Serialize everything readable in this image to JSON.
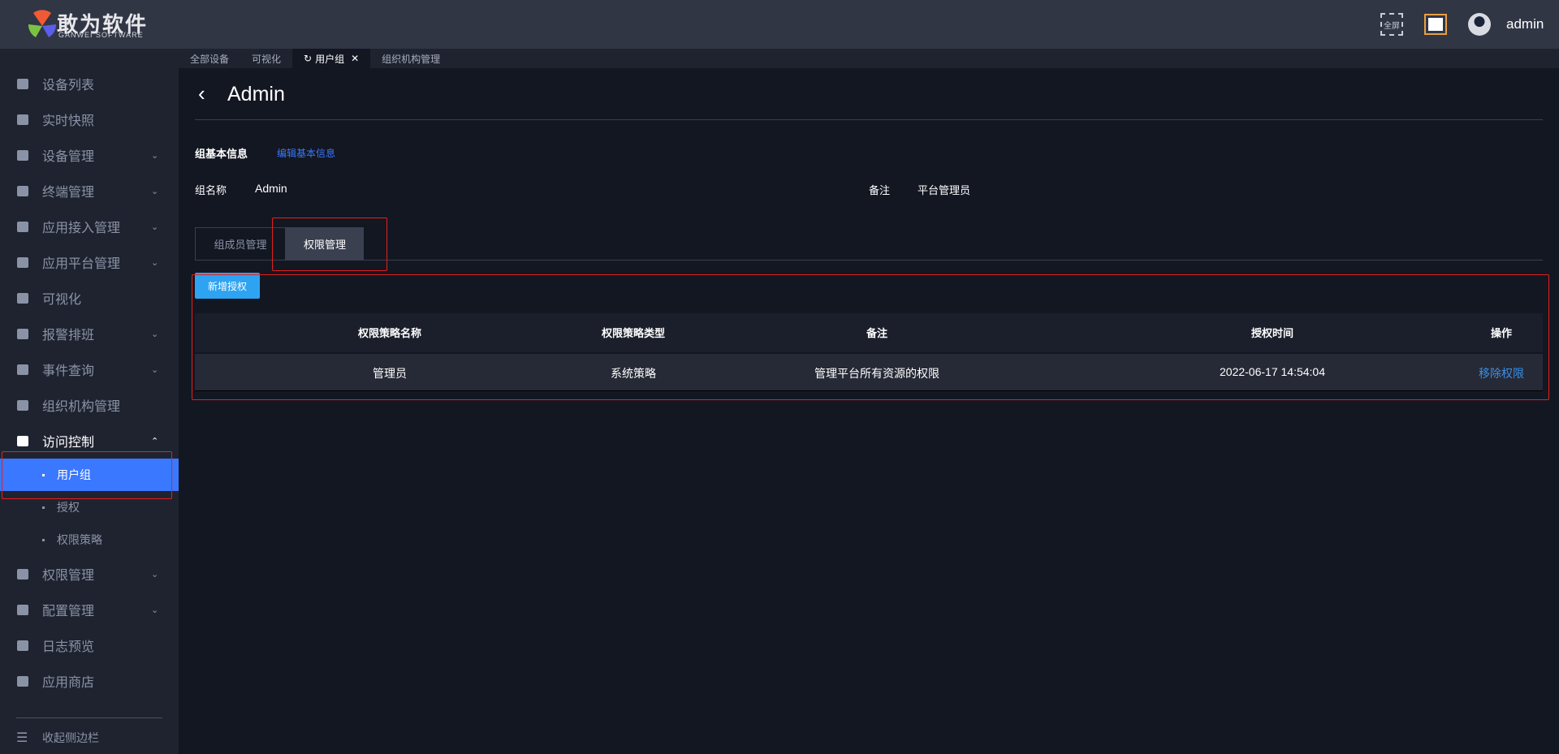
{
  "header": {
    "brand": "敢为软件",
    "brand_sub": "GANWEI SOFTWARE",
    "fullscreen_label": "全屏",
    "username": "admin"
  },
  "tabs": [
    {
      "label": "全部设备"
    },
    {
      "label": "可视化"
    },
    {
      "label": "用户组"
    },
    {
      "label": "组织机构管理"
    }
  ],
  "sidebar": {
    "items": [
      {
        "label": "设备列表",
        "icon": "monitor-icon"
      },
      {
        "label": "实时快照",
        "icon": "camera-icon"
      },
      {
        "label": "设备管理",
        "icon": "grid-icon",
        "chevron": true
      },
      {
        "label": "终端管理",
        "icon": "grid-icon",
        "chevron": true
      },
      {
        "label": "应用接入管理",
        "icon": "grid-icon",
        "chevron": true
      },
      {
        "label": "应用平台管理",
        "icon": "grid-icon",
        "chevron": true
      },
      {
        "label": "可视化",
        "icon": "grid-icon"
      },
      {
        "label": "报警排班",
        "icon": "calendar-icon",
        "chevron": true
      },
      {
        "label": "事件查询",
        "icon": "search-doc-icon",
        "chevron": true
      },
      {
        "label": "组织机构管理",
        "icon": "gear-icon"
      },
      {
        "label": "访问控制",
        "icon": "document-icon"
      }
    ],
    "subitems": [
      {
        "label": "用户组"
      },
      {
        "label": "授权"
      },
      {
        "label": "权限策略"
      }
    ],
    "items2": [
      {
        "label": "权限管理",
        "icon": "shield-icon",
        "chevron": true
      },
      {
        "label": "配置管理",
        "icon": "bookmark-icon",
        "chevron": true
      },
      {
        "label": "日志预览",
        "icon": "document-icon"
      },
      {
        "label": "应用商店",
        "icon": "store-icon"
      }
    ],
    "collapse": "收起侧边栏"
  },
  "page": {
    "title": "Admin",
    "section_title": "组基本信息",
    "edit_link": "编辑基本信息",
    "name_label": "组名称",
    "name_value": "Admin",
    "remark_label": "备注",
    "remark_value": "平台管理员",
    "inner_tabs": [
      "组成员管理",
      "权限管理"
    ],
    "add_button": "新增授权"
  },
  "table": {
    "headers": [
      "权限策略名称",
      "权限策略类型",
      "备注",
      "授权时间",
      "操作"
    ],
    "rows": [
      {
        "name": "管理员",
        "type": "系统策略",
        "remark": "管理平台所有资源的权限",
        "time": "2022-06-17 14:54:04",
        "action": "移除权限"
      }
    ]
  },
  "colors": {
    "accent": "#3a78ff",
    "link": "#3a8ee6",
    "button": "#2ea3f2"
  }
}
